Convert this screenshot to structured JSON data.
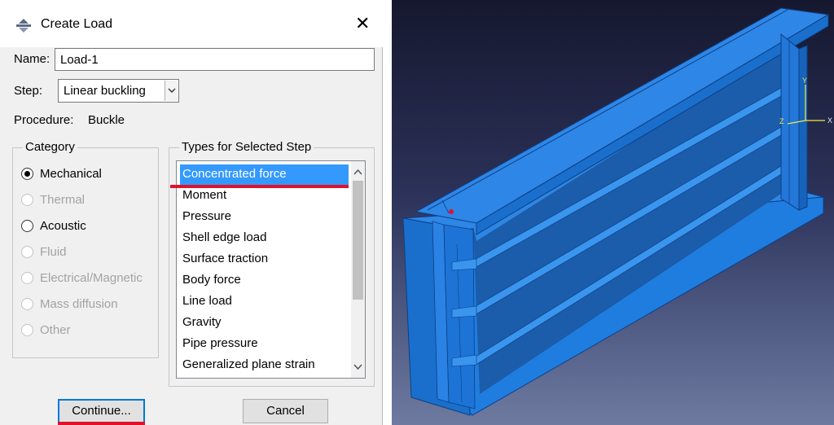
{
  "dialog": {
    "title": "Create Load",
    "close_glyph": "✕",
    "name_label": "Name:",
    "name_value": "Load-1",
    "step_label": "Step:",
    "step_value": "Linear buckling",
    "procedure_label": "Procedure:",
    "procedure_value": "Buckle",
    "category": {
      "legend": "Category",
      "options": [
        {
          "label": "Mechanical",
          "checked": true,
          "enabled": true
        },
        {
          "label": "Thermal",
          "checked": false,
          "enabled": false
        },
        {
          "label": "Acoustic",
          "checked": false,
          "enabled": true
        },
        {
          "label": "Fluid",
          "checked": false,
          "enabled": false
        },
        {
          "label": "Electrical/Magnetic",
          "checked": false,
          "enabled": false
        },
        {
          "label": "Mass diffusion",
          "checked": false,
          "enabled": false
        },
        {
          "label": "Other",
          "checked": false,
          "enabled": false
        }
      ]
    },
    "types": {
      "legend": "Types for Selected Step",
      "items": [
        "Concentrated force",
        "Moment",
        "Pressure",
        "Shell edge load",
        "Surface traction",
        "Body force",
        "Line load",
        "Gravity",
        "Pipe pressure",
        "Generalized plane strain"
      ],
      "selected": "Concentrated force"
    },
    "continue_label": "Continue...",
    "cancel_label": "Cancel"
  },
  "viewport": {
    "triad": {
      "y": "Y",
      "x": "X",
      "z": "Z"
    }
  },
  "colors": {
    "selection": "#3399ff",
    "highlight_underline": "#e0112b",
    "model_blue": "#1f7de0",
    "viewport_top": "#16182f",
    "viewport_bottom": "#6e7aa0",
    "triad_axis": "#f4e84a"
  },
  "icons": {
    "app": "create-load-icon",
    "close": "close-icon",
    "dropdown": "chevron-down-icon",
    "scroll_up": "chevron-up-icon",
    "scroll_down": "chevron-down-icon"
  }
}
